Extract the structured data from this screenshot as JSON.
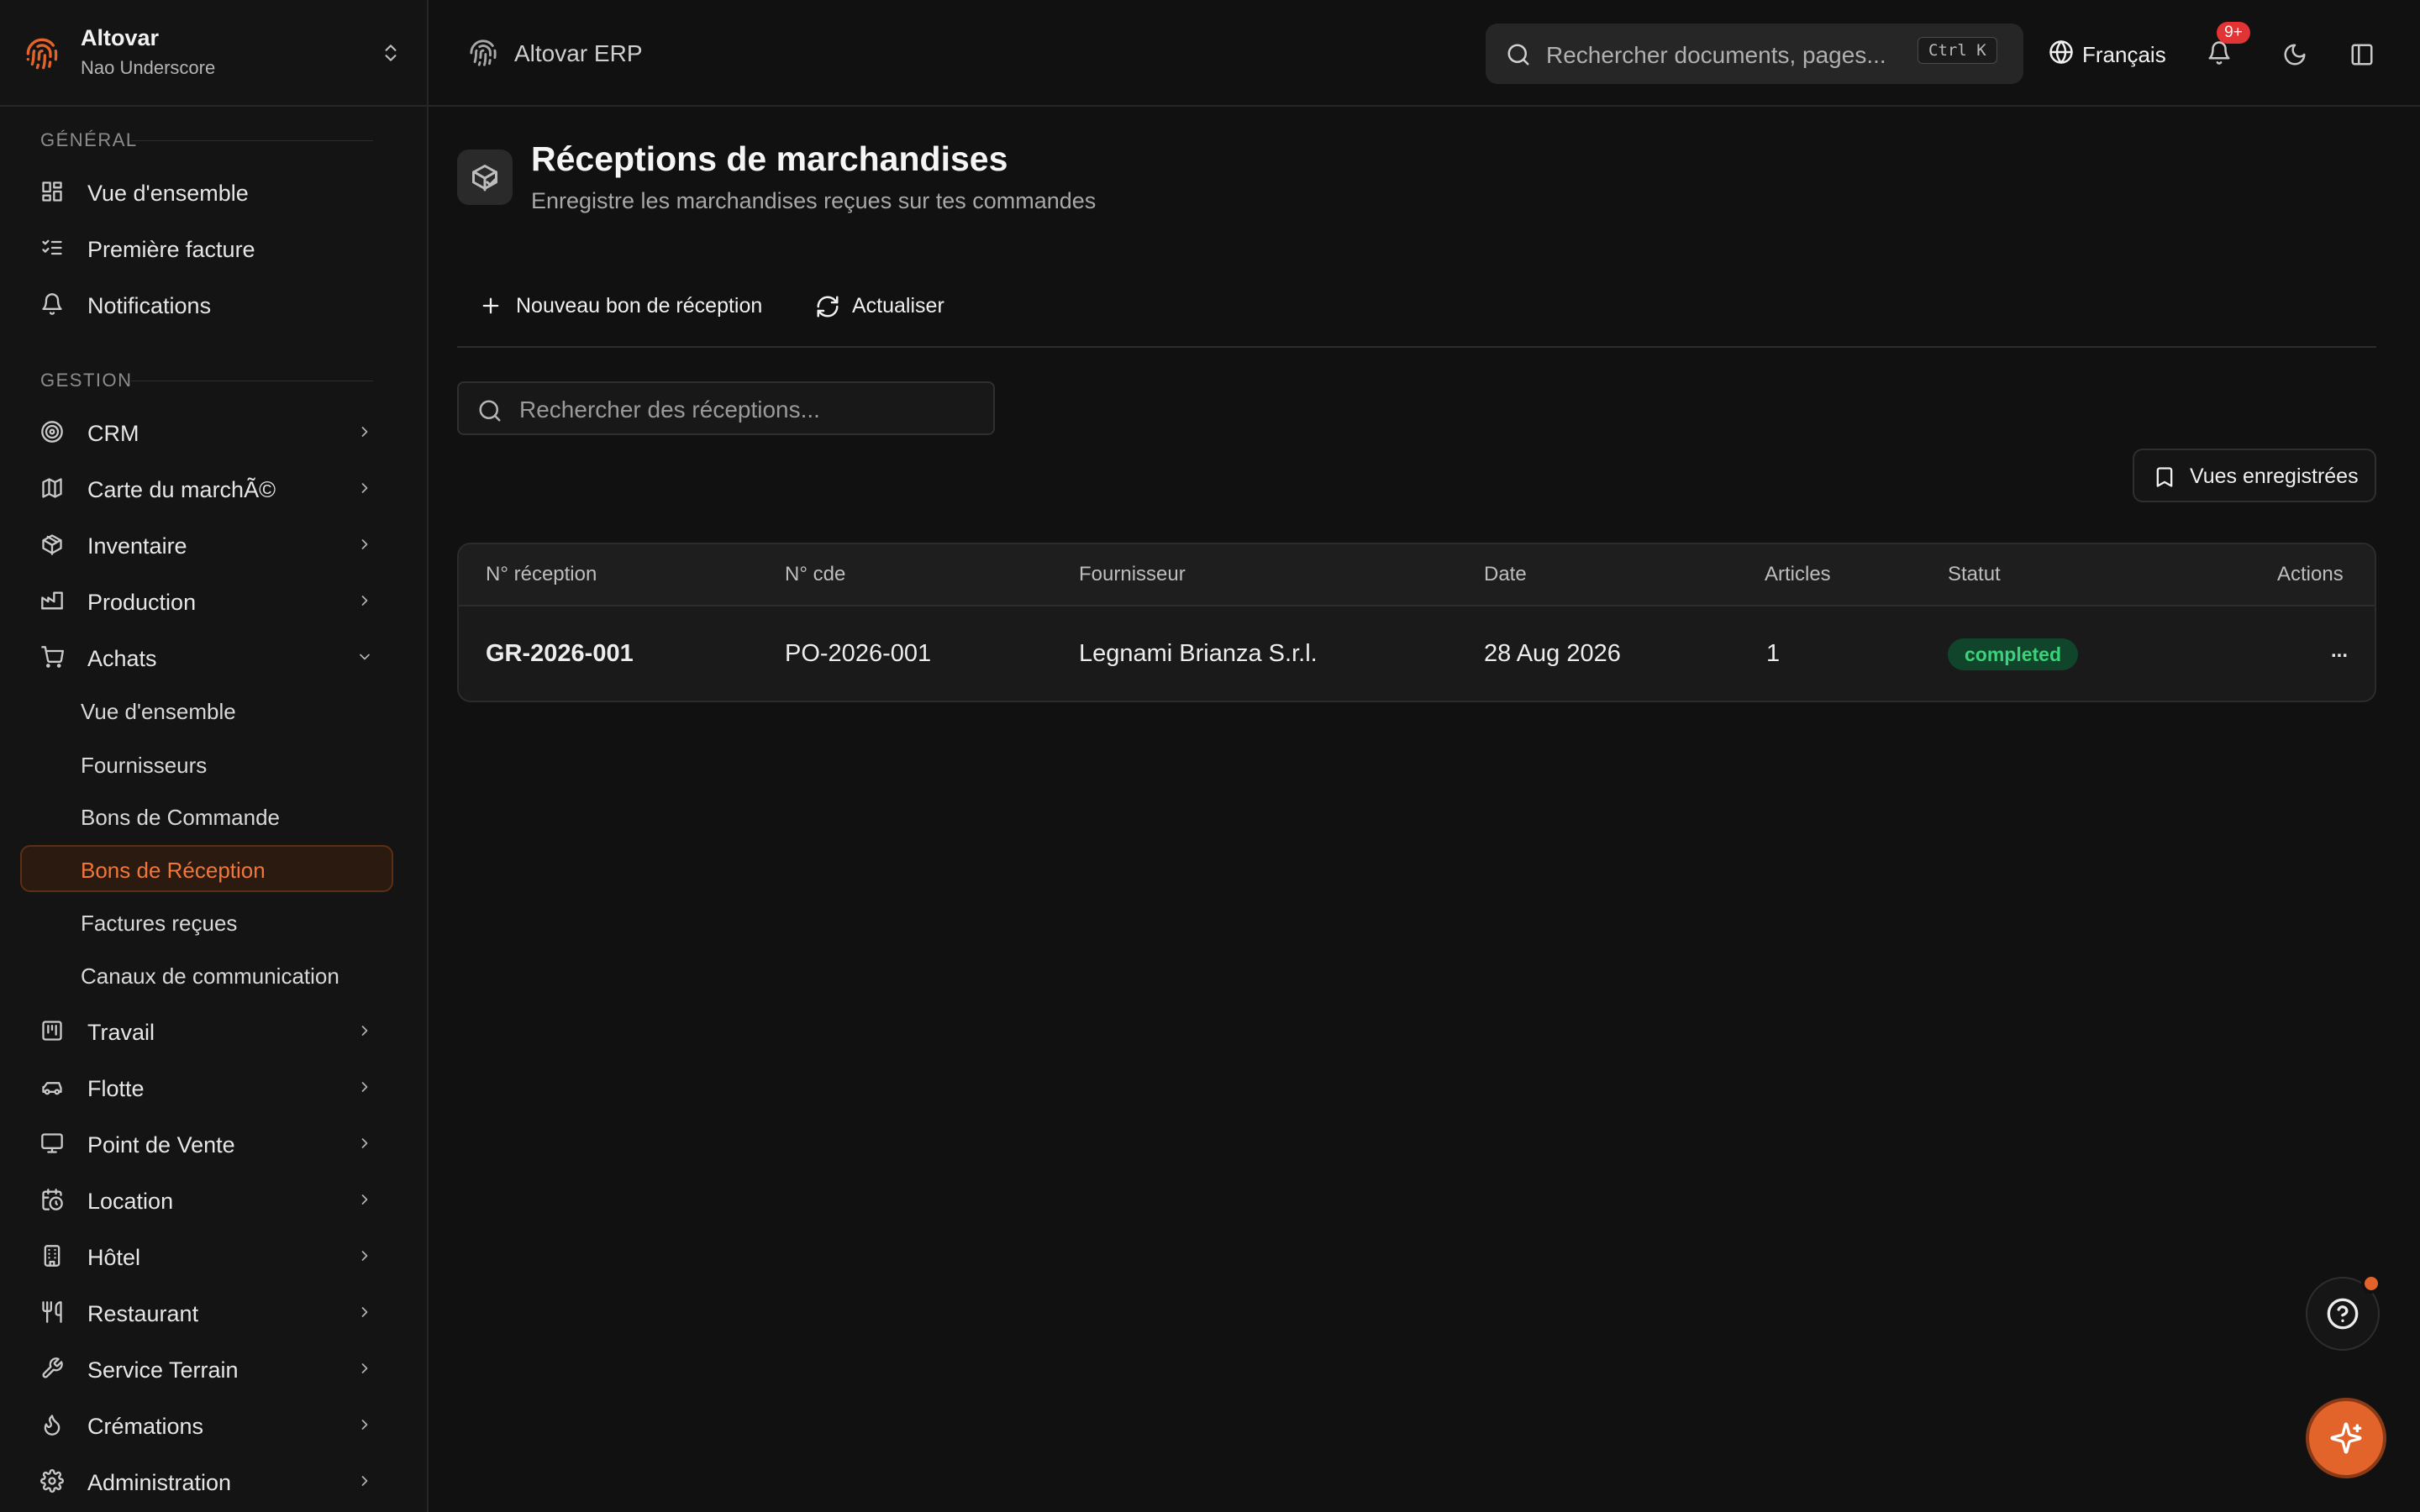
{
  "org": {
    "name": "Altovar",
    "user": "Nao Underscore"
  },
  "header": {
    "brand": "Altovar ERP",
    "search_placeholder": "Rechercher documents, pages...",
    "search_shortcut": "Ctrl K",
    "language": "Français",
    "notifications_badge": "9+"
  },
  "sidebar": {
    "general_label": "GÉNÉRAL",
    "general_items": [
      {
        "label": "Vue d'ensemble",
        "icon": "dashboard-icon"
      },
      {
        "label": "Première facture",
        "icon": "checklist-icon"
      },
      {
        "label": "Notifications",
        "icon": "bell-icon"
      }
    ],
    "gestion_label": "GESTION",
    "gestion_items": [
      {
        "label": "CRM",
        "icon": "target-icon"
      },
      {
        "label": "Carte du marchÃ©",
        "icon": "map-icon"
      },
      {
        "label": "Inventaire",
        "icon": "package-icon"
      },
      {
        "label": "Production",
        "icon": "factory-icon"
      },
      {
        "label": "Achats",
        "icon": "cart-icon",
        "expanded": true
      }
    ],
    "achats_sub": [
      {
        "label": "Vue d'ensemble"
      },
      {
        "label": "Fournisseurs"
      },
      {
        "label": "Bons de Commande"
      },
      {
        "label": "Bons de Réception",
        "active": true
      },
      {
        "label": "Factures reçues"
      },
      {
        "label": "Canaux de communication"
      }
    ],
    "more_items": [
      {
        "label": "Travail",
        "icon": "kanban-icon"
      },
      {
        "label": "Flotte",
        "icon": "car-icon"
      },
      {
        "label": "Point de Vente",
        "icon": "monitor-icon"
      },
      {
        "label": "Location",
        "icon": "calendar-clock-icon"
      },
      {
        "label": "Hôtel",
        "icon": "building-icon"
      },
      {
        "label": "Restaurant",
        "icon": "utensils-icon"
      },
      {
        "label": "Service Terrain",
        "icon": "wrench-icon"
      },
      {
        "label": "Crémations",
        "icon": "flame-icon"
      },
      {
        "label": "Administration",
        "icon": "gear-icon"
      }
    ]
  },
  "page": {
    "title": "Réceptions de marchandises",
    "subtitle": "Enregistre les marchandises reçues sur tes commandes",
    "new_button": "Nouveau bon de réception",
    "refresh_button": "Actualiser",
    "search_placeholder": "Rechercher des réceptions...",
    "saved_views": "Vues enregistrées"
  },
  "table": {
    "columns": [
      "N° réception",
      "N° cde",
      "Fournisseur",
      "Date",
      "Articles",
      "Statut",
      "Actions"
    ],
    "rows": [
      {
        "reception": "GR-2026-001",
        "order": "PO-2026-001",
        "supplier": "Legnami Brianza S.r.l.",
        "date": "28 Aug 2026",
        "articles": "1",
        "status": "completed",
        "actions": "..."
      }
    ]
  },
  "colors": {
    "accent": "#e2642a",
    "status_completed": "#3ad27a",
    "badge_red": "#e23434"
  }
}
